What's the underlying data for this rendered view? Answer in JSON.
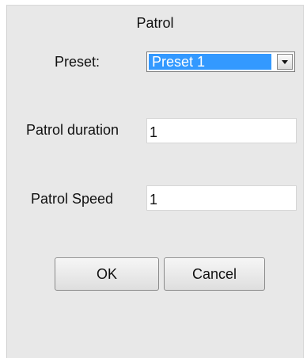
{
  "dialog": {
    "title": "Patrol",
    "preset": {
      "label": "Preset:",
      "selected": "Preset 1"
    },
    "duration": {
      "label": "Patrol duration",
      "value": "1"
    },
    "speed": {
      "label": "Patrol Speed",
      "value": "1"
    },
    "buttons": {
      "ok": "OK",
      "cancel": "Cancel"
    }
  }
}
